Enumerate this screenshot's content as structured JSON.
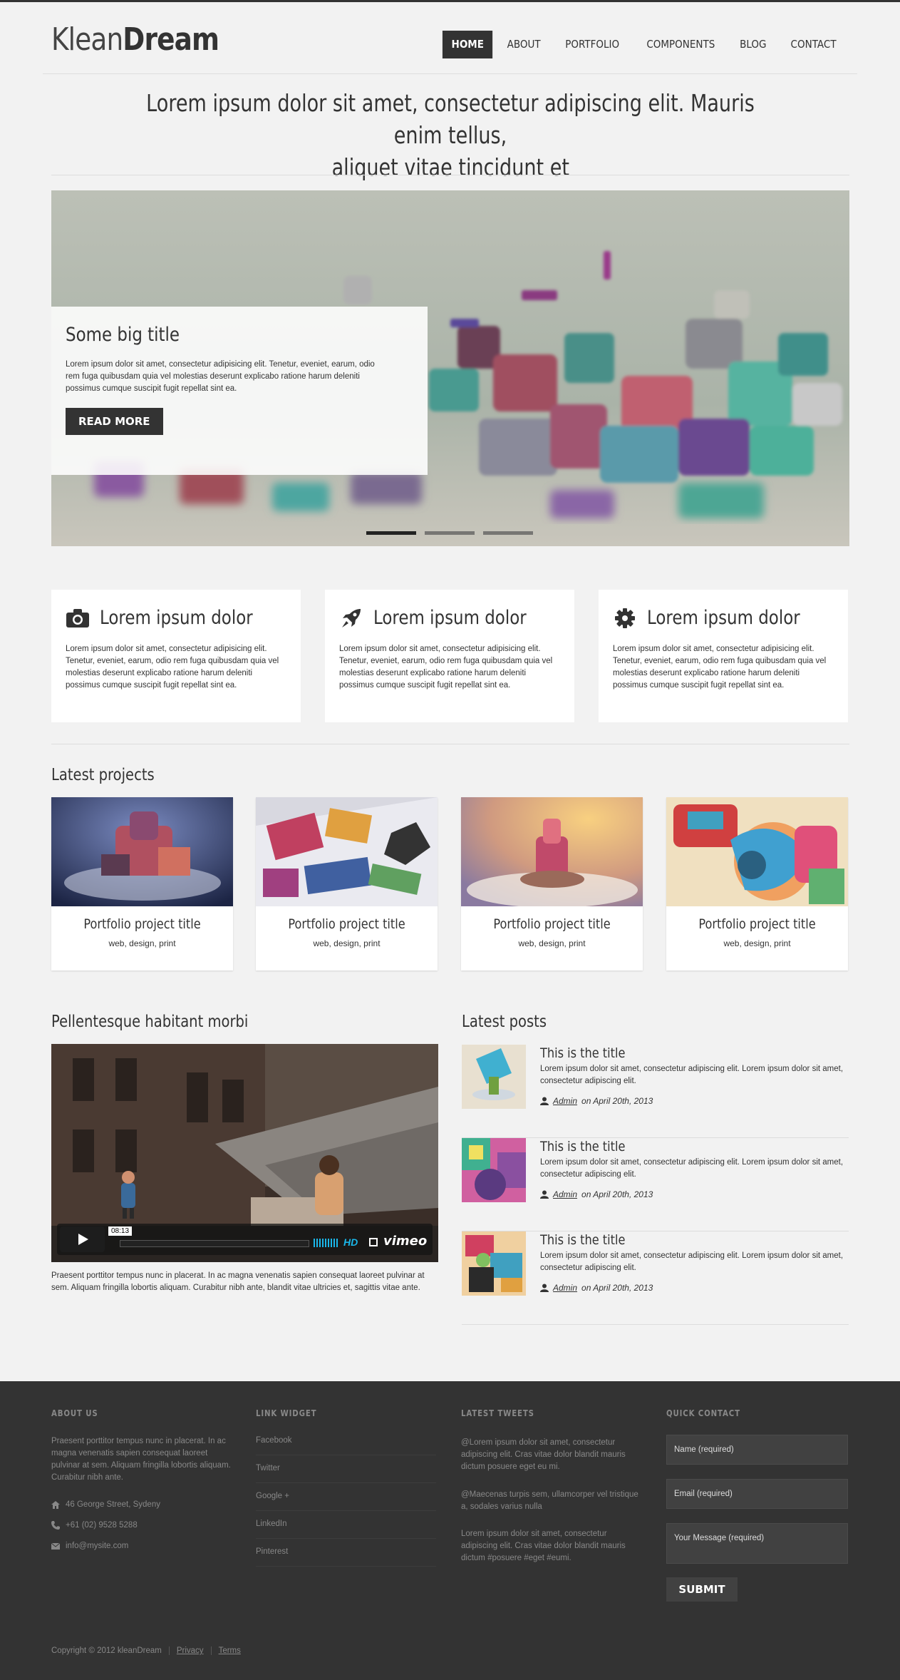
{
  "brand": {
    "logo_light": "Klean",
    "logo_bold": "Dream"
  },
  "nav": [
    {
      "label": "HOME",
      "active": true
    },
    {
      "label": "ABOUT"
    },
    {
      "label": "PORTFOLIO"
    },
    {
      "label": "COMPONENTS"
    },
    {
      "label": "BLOG"
    },
    {
      "label": "CONTACT"
    }
  ],
  "tagline": {
    "line1": "Lorem ipsum dolor sit amet, consectetur adipiscing elit. Mauris enim tellus,",
    "line2": "aliquet vitae tincidunt et"
  },
  "slider": {
    "title": "Some big title",
    "text": "Lorem ipsum dolor sit amet, consectetur adipisicing elit. Tenetur, eveniet, earum, odio rem fuga quibusdam quia vel molestias deserunt explicabo ratione harum deleniti possimus cumque suscipit fugit repellat sint ea.",
    "button": "READ MORE",
    "active_slide": 1,
    "slide_count": 3
  },
  "features": [
    {
      "icon": "camera-icon",
      "title": "Lorem ipsum dolor",
      "text": "Lorem ipsum dolor sit amet, consectetur adipisicing elit. Tenetur, eveniet, earum, odio rem fuga quibusdam quia vel molestias deserunt explicabo ratione harum deleniti possimus cumque suscipit fugit repellat sint ea."
    },
    {
      "icon": "rocket-icon",
      "title": "Lorem ipsum dolor",
      "text": "Lorem ipsum dolor sit amet, consectetur adipisicing elit. Tenetur, eveniet, earum, odio rem fuga quibusdam quia vel molestias deserunt explicabo ratione harum deleniti possimus cumque suscipit fugit repellat sint ea."
    },
    {
      "icon": "gear-icon",
      "title": "Lorem ipsum dolor",
      "text": "Lorem ipsum dolor sit amet, consectetur adipisicing elit. Tenetur, eveniet, earum, odio rem fuga quibusdam quia vel molestias deserunt explicabo ratione harum deleniti possimus cumque suscipit fugit repellat sint ea."
    }
  ],
  "projects": {
    "heading": "Latest projects",
    "items": [
      {
        "title": "Portfolio project title",
        "tags": "web, design, print"
      },
      {
        "title": "Portfolio project title",
        "tags": "web, design, print"
      },
      {
        "title": "Portfolio project title",
        "tags": "web, design, print"
      },
      {
        "title": "Portfolio project title",
        "tags": "web, design, print"
      }
    ]
  },
  "video": {
    "heading": "Pellentesque habitant morbi",
    "duration": "08:13",
    "hd": "HD",
    "provider": "vimeo",
    "caption": "Praesent porttitor tempus nunc in placerat. In ac magna venenatis sapien consequat laoreet pulvinar at sem. Aliquam fringilla lobortis aliquam. Curabitur nibh ante, blandit vitae ultricies et, sagittis vitae ante."
  },
  "posts": {
    "heading": "Latest posts",
    "items": [
      {
        "title": "This is the title",
        "text": "Lorem ipsum dolor sit amet, consectetur adipiscing elit. Lorem ipsum dolor sit amet, consectetur adipiscing elit.",
        "author": "Admin",
        "date": "on April 20th, 2013"
      },
      {
        "title": "This is the title",
        "text": "Lorem ipsum dolor sit amet, consectetur adipiscing elit. Lorem ipsum dolor sit amet, consectetur adipiscing elit.",
        "author": "Admin",
        "date": "on April 20th, 2013"
      },
      {
        "title": "This is the title",
        "text": "Lorem ipsum dolor sit amet, consectetur adipiscing elit. Lorem ipsum dolor sit amet, consectetur adipiscing elit.",
        "author": "Admin",
        "date": "on April 20th, 2013"
      }
    ]
  },
  "footer": {
    "about": {
      "title": "ABOUT US",
      "text": "Praesent porttitor tempus nunc in placerat. In ac magna venenatis sapien consequat laoreet pulvinar at sem. Aliquam fringilla lobortis aliquam. Curabitur nibh ante.",
      "address": "46 George Street, Sydeny",
      "phone": "+61 (02) 9528 5288",
      "email": "info@mysite.com"
    },
    "links": {
      "title": "LINK WIDGET",
      "items": [
        "Facebook",
        "Twitter",
        "Google +",
        "LinkedIn",
        "Pinterest"
      ]
    },
    "tweets": {
      "title": "LATEST TWEETS",
      "items": [
        "@Lorem ipsum dolor sit amet, consectetur adipiscing elit. Cras vitae dolor blandit mauris dictum posuere eget eu mi.",
        "@Maecenas turpis sem, ullamcorper vel tristique a, sodales varius nulla",
        "Lorem ipsum dolor sit amet, consectetur adipiscing elit. Cras vitae dolor blandit mauris dictum #posuere #eget #eumi."
      ]
    },
    "contact": {
      "title": "QUICK CONTACT",
      "name_placeholder": "Name (required)",
      "email_placeholder": "Email (required)",
      "message_placeholder": "Your Message (required)",
      "submit": "SUBMIT"
    },
    "copyright": "Copyright © 2012 kleanDream",
    "privacy": "Privacy",
    "terms": "Terms"
  },
  "colors": {
    "dark": "#333333",
    "background": "#f2f2f2",
    "footer": "#333333",
    "accent_blue": "#1ab7ea"
  }
}
